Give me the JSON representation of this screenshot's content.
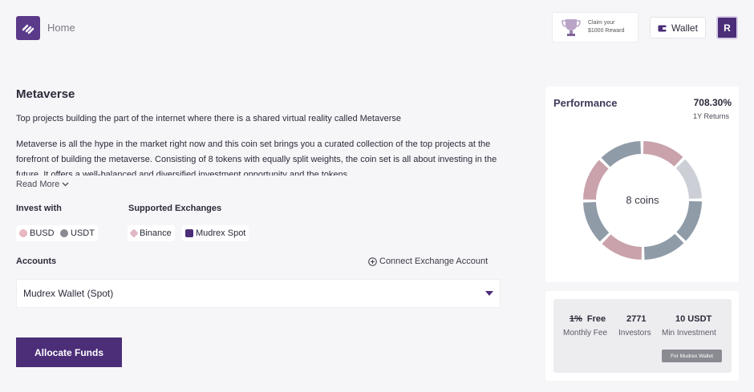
{
  "header": {
    "home_label": "Home",
    "reward_line1": "Claim your",
    "reward_line2": "$1000 Reward",
    "wallet_label": "Wallet",
    "avatar_initial": "R"
  },
  "coinset": {
    "title": "Metaverse",
    "subtitle": "Top projects building the part of the internet where there is a shared virtual reality called Metaverse",
    "description": "Metaverse is all the hype in the market right now and this coin set brings you a curated collection of the top projects at the forefront of building the metaverse. Consisting of 8 tokens with equally split weights, the coin set is all about investing in the future. It offers a well-balanced and diversified investment opportunity and the tokens",
    "read_more": "Read More"
  },
  "invest": {
    "label": "Invest with",
    "options": [
      {
        "name": "BUSD",
        "color": "#e9b7c1"
      },
      {
        "name": "USDT",
        "color": "#8a8a92"
      }
    ]
  },
  "exchanges": {
    "label": "Supported Exchanges",
    "options": [
      {
        "name": "Binance",
        "color": "#e2b7c4"
      },
      {
        "name": "Mudrex Spot",
        "color": "#4b2d78"
      }
    ]
  },
  "accounts": {
    "label": "Accounts",
    "connect_label": "Connect Exchange Account",
    "selected": "Mudrex Wallet (Spot)"
  },
  "allocate_label": "Allocate Funds",
  "performance": {
    "title": "Performance",
    "value": "708.30%",
    "sub": "1Y Returns",
    "center_label": "8 coins",
    "segment_colors": [
      "#c9a2ab",
      "#ccd0d6",
      "#909ba8",
      "#909ba8",
      "#c9a2ab",
      "#909ba8",
      "#c9a2ab",
      "#909ba8"
    ],
    "coins": 8
  },
  "stats": {
    "fee_old": "1%",
    "fee_new": "Free",
    "fee_label": "Monthly Fee",
    "investors": "2771",
    "investors_label": "Investors",
    "min_investment": "10 USDT",
    "min_label": "Min Investment",
    "tag": "For Mudrex Wallet"
  },
  "colors": {
    "accent": "#4b2d78",
    "background": "#f6f6f8"
  }
}
